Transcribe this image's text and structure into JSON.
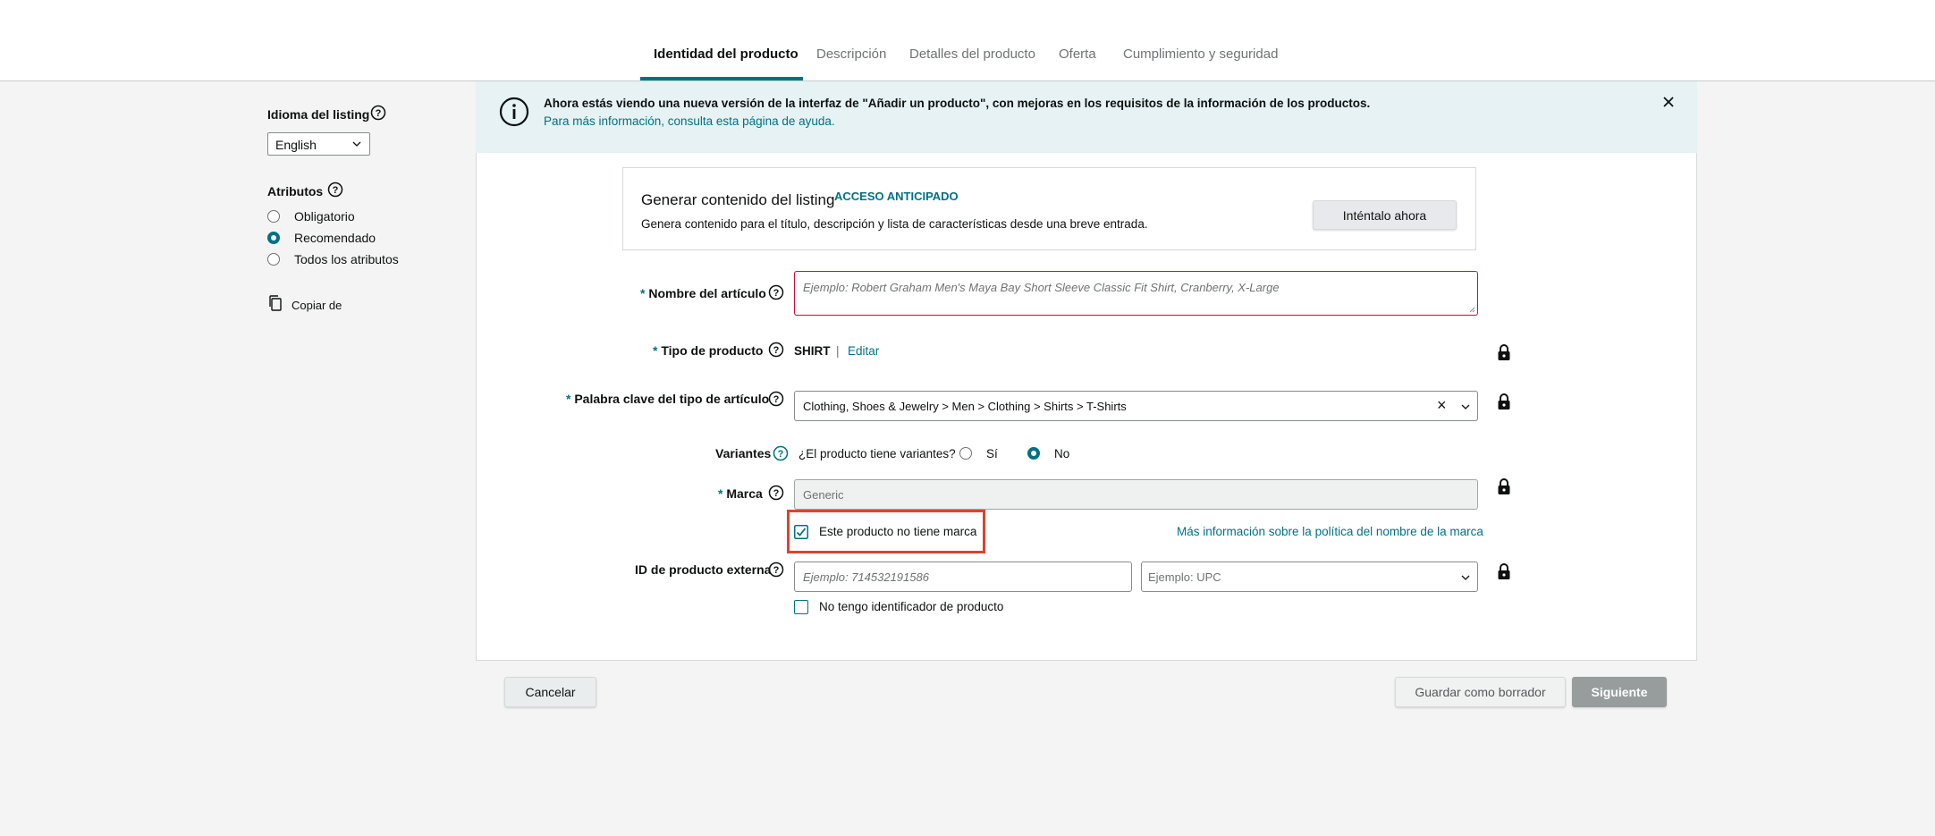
{
  "tabs": [
    {
      "label": "Identidad del producto",
      "active": true
    },
    {
      "label": "Descripción",
      "active": false
    },
    {
      "label": "Detalles del producto",
      "active": false
    },
    {
      "label": "Oferta",
      "active": false
    },
    {
      "label": "Cumplimiento y seguridad",
      "active": false
    }
  ],
  "sidebar": {
    "language_label": "Idioma del listing",
    "language_value": "English",
    "attributes_label": "Atributos",
    "attribute_options": [
      {
        "label": "Obligatorio",
        "selected": false
      },
      {
        "label": "Recomendado",
        "selected": true
      },
      {
        "label": "Todos los atributos",
        "selected": false
      }
    ],
    "copy_from": "Copiar de"
  },
  "banner": {
    "message": "Ahora estás viendo una nueva versión de la interfaz de \"Añadir un producto\", con mejoras en los requisitos de la información de los productos.",
    "link": "Para más información, consulta esta página de ayuda."
  },
  "generate_card": {
    "title": "Generar contenido del listing",
    "badge": "ACCESO ANTICIPADO",
    "description": "Genera contenido para el título, descripción y lista de características desde una breve entrada.",
    "button": "Inténtalo ahora"
  },
  "form": {
    "item_name": {
      "label": "Nombre del artículo",
      "placeholder": "Ejemplo: Robert Graham Men's Maya Bay Short Sleeve Classic Fit Shirt, Cranberry, X-Large"
    },
    "product_type": {
      "label": "Tipo de producto",
      "value": "SHIRT",
      "separator": "|",
      "edit": "Editar"
    },
    "keyword": {
      "label": "Palabra clave del tipo de artículo",
      "value": "Clothing, Shoes & Jewelry > Men > Clothing > Shirts > T-Shirts",
      "clear": "×"
    },
    "variants": {
      "label": "Variantes",
      "question": "¿El producto tiene variantes?",
      "yes": "Sí",
      "no": "No",
      "selected": "No"
    },
    "brand": {
      "label": "Marca",
      "value": "Generic",
      "no_brand_checkbox": "Este producto no tiene marca",
      "no_brand_checked": true,
      "policy_link": "Más información sobre la política del nombre de la marca"
    },
    "external_id": {
      "label": "ID de producto externa",
      "id_placeholder": "Ejemplo: 714532191586",
      "type_placeholder": "Ejemplo: UPC",
      "no_id_checkbox": "No tengo identificador de producto",
      "no_id_checked": false
    }
  },
  "required_mark": "*",
  "footer": {
    "cancel": "Cancelar",
    "save_draft": "Guardar como borrador",
    "next": "Siguiente"
  },
  "colors": {
    "accent": "#007185",
    "highlight_box": "#e0422b",
    "banner_bg": "#e6f2f3",
    "invalid_border": "#cc0c39"
  }
}
